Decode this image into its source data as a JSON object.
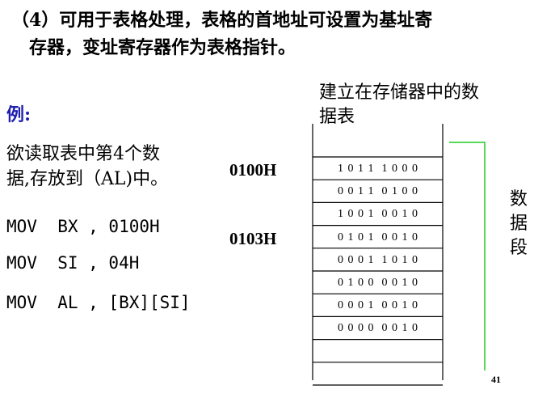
{
  "heading": "（4）可用于表格处理，表格的首地址可设置为基址寄\n　存器，变址寄存器作为表格指针。",
  "example_label": "例:",
  "task_line1": "欲读取表中第4个数",
  "task_line2": "据,存放到（AL)中。",
  "code_lines": [
    "MOV  BX , 0100H",
    "MOV  SI , 04H",
    "MOV  AL , [BX][SI]"
  ],
  "table_caption": "建立在存储器中的数据表",
  "address_labels": [
    "0100H",
    "0103H"
  ],
  "memory_cells": [
    "1 0 1 1  1 0 0 0",
    "0 0 1 1  0 1 0 0",
    "1 0 0 1  0 0 1 0",
    "0 1 0 1  0 0 1 0",
    "0 0 0 1  1 0 1 0",
    "0 1 0 0  0 0 1 0",
    "0 0 0 1  0 0 1 0",
    "0 0 0 0  0 0 1 0"
  ],
  "segment_label": "数据段",
  "page_number": "41",
  "colors": {
    "example_label": "#1f1fb0",
    "bracket": "#22cc22"
  }
}
